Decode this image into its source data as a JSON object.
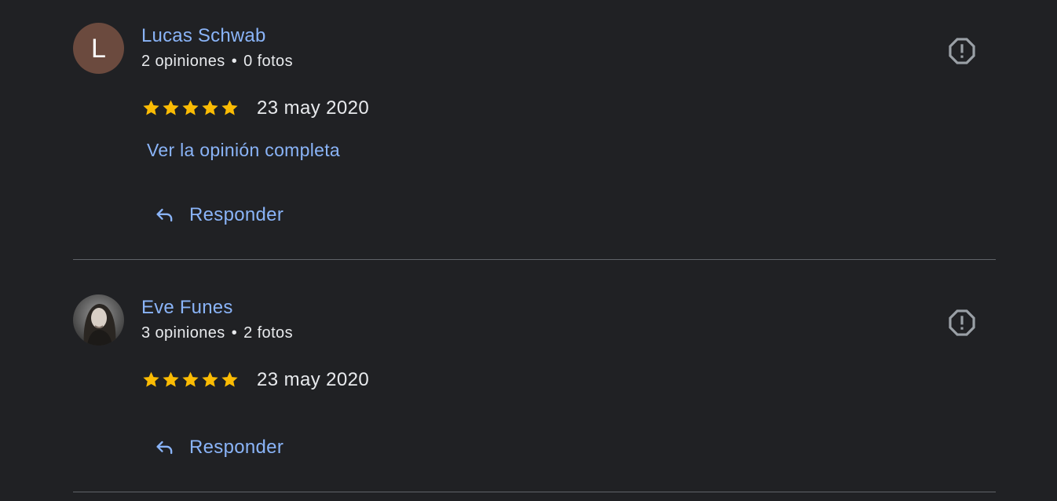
{
  "reviews": [
    {
      "author": "Lucas Schwab",
      "avatar_letter": "L",
      "reviews_count": "2 opiniones",
      "photos_count": "0 fotos",
      "separator": "•",
      "rating": 5,
      "date": "23 may 2020",
      "more_link": "Ver la opinión completa",
      "reply_label": "Responder",
      "flag_icon": "report-flag-icon"
    },
    {
      "author": "Eve Funes",
      "avatar_letter": "",
      "reviews_count": "3 opiniones",
      "photos_count": "2 fotos",
      "separator": "•",
      "rating": 5,
      "date": "23 may 2020",
      "reply_label": "Responder",
      "flag_icon": "report-flag-icon"
    }
  ],
  "colors": {
    "background": "#202124",
    "link": "#8ab4f8",
    "text": "#e8eaed",
    "star": "#fbbc04",
    "divider": "#5f6368",
    "icon": "#9aa0a6"
  }
}
